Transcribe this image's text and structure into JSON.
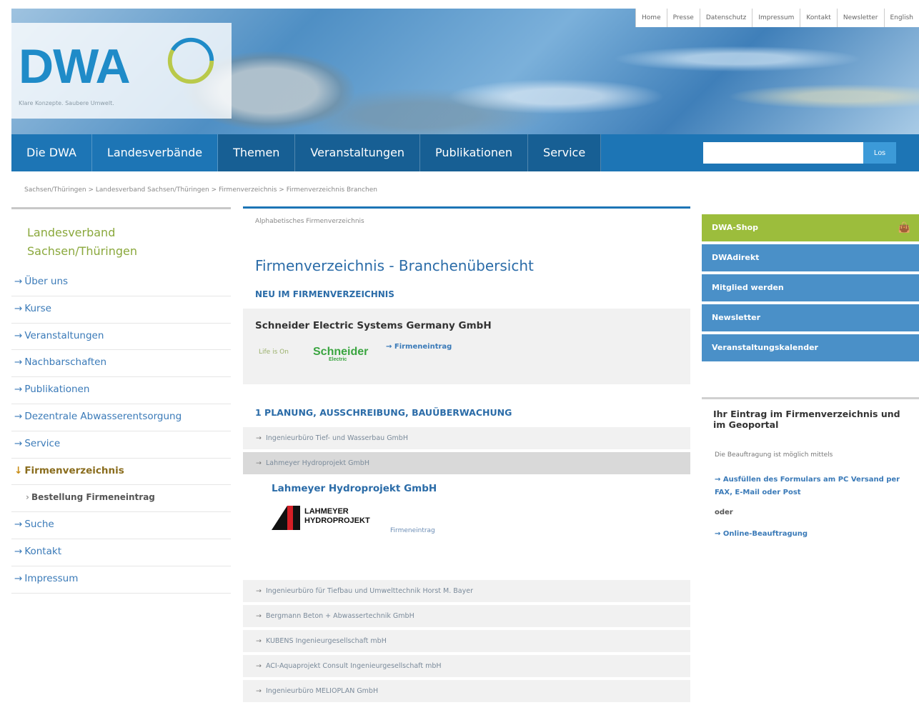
{
  "header": {
    "logo_text": "DWA",
    "tagline": "Klare Konzepte. Saubere Umwelt.",
    "top_nav": [
      "Home",
      "Presse",
      "Datenschutz",
      "Impressum",
      "Kontakt",
      "Newsletter",
      "English"
    ]
  },
  "main_nav": [
    "Die DWA",
    "Landesverbände",
    "Themen",
    "Veranstaltungen",
    "Publikationen",
    "Service"
  ],
  "search": {
    "button": "Los",
    "placeholder": ""
  },
  "breadcrumb": "Sachsen/Thüringen > Landesverband Sachsen/Thüringen > Firmenverzeichnis > Firmenverzeichnis Branchen",
  "sidebar": {
    "title": "Landesverband Sachsen/Thüringen",
    "items": [
      {
        "label": "Über uns",
        "arrow": "→"
      },
      {
        "label": "Kurse",
        "arrow": "→"
      },
      {
        "label": "Veranstaltungen",
        "arrow": "→"
      },
      {
        "label": "Nachbarschaften",
        "arrow": "→"
      },
      {
        "label": "Publikationen",
        "arrow": "→"
      },
      {
        "label": "Dezentrale Abwasserentsorgung",
        "arrow": "→"
      },
      {
        "label": "Service",
        "arrow": "→"
      },
      {
        "label": "Firmenverzeichnis",
        "arrow": "↓"
      },
      {
        "label": "Bestellung Firmeneintrag",
        "arrow": "›"
      },
      {
        "label": "Suche",
        "arrow": "→"
      },
      {
        "label": "Kontakt",
        "arrow": "→"
      },
      {
        "label": "Impressum",
        "arrow": "→"
      }
    ]
  },
  "main": {
    "alpha_link": "Alphabetisches Firmenverzeichnis",
    "title": "Firmenverzeichnis - Branchenübersicht",
    "new_heading": "NEU IM FIRMENVERZEICHNIS",
    "new_company": "Schneider Electric Systems Germany GmbH",
    "new_tagline": "Life is On",
    "new_logo": "Schneider",
    "new_logo_sub": "Electric",
    "new_link": "→ Firmeneintrag",
    "category_heading": "1 PLANUNG, AUSSCHREIBUNG, BAUÜBERWACHUNG",
    "companies": [
      "Ingenieurbüro Tief- und Wasserbau GmbH",
      "Lahmeyer Hydroprojekt GmbH",
      "Ingenieurbüro für Tiefbau und Umwelttechnik Horst M. Bayer",
      "Bergmann Beton + Abwassertechnik GmbH",
      "KUBENS Ingenieurgesellschaft mbH",
      "ACI-Aquaprojekt Consult Ingenieurgesellschaft mbH",
      "Ingenieurbüro MELIOPLAN GmbH"
    ],
    "detail": {
      "title": "Lahmeyer Hydroprojekt GmbH",
      "logo_line1": "LAHMEYER",
      "logo_line2": "HYDROPROJEKT",
      "link": "Firmeneintrag"
    }
  },
  "right": {
    "buttons": [
      "DWA-Shop",
      "DWAdirekt",
      "Mitglied werden",
      "Newsletter",
      "Veranstaltungskalender"
    ],
    "box_title": "Ihr Eintrag im Firmenverzeichnis und im Geoportal",
    "box_text": "Die Beauftragung ist möglich mittels",
    "link1": "→ Ausfüllen des Formulars am PC Versand per FAX, E-Mail oder Post",
    "oder": "oder",
    "link2": "→ Online-Beauftragung"
  },
  "colors": {
    "brand_blue": "#1d75b5",
    "green": "#9cbd3c",
    "link_blue": "#3a7ab8"
  }
}
